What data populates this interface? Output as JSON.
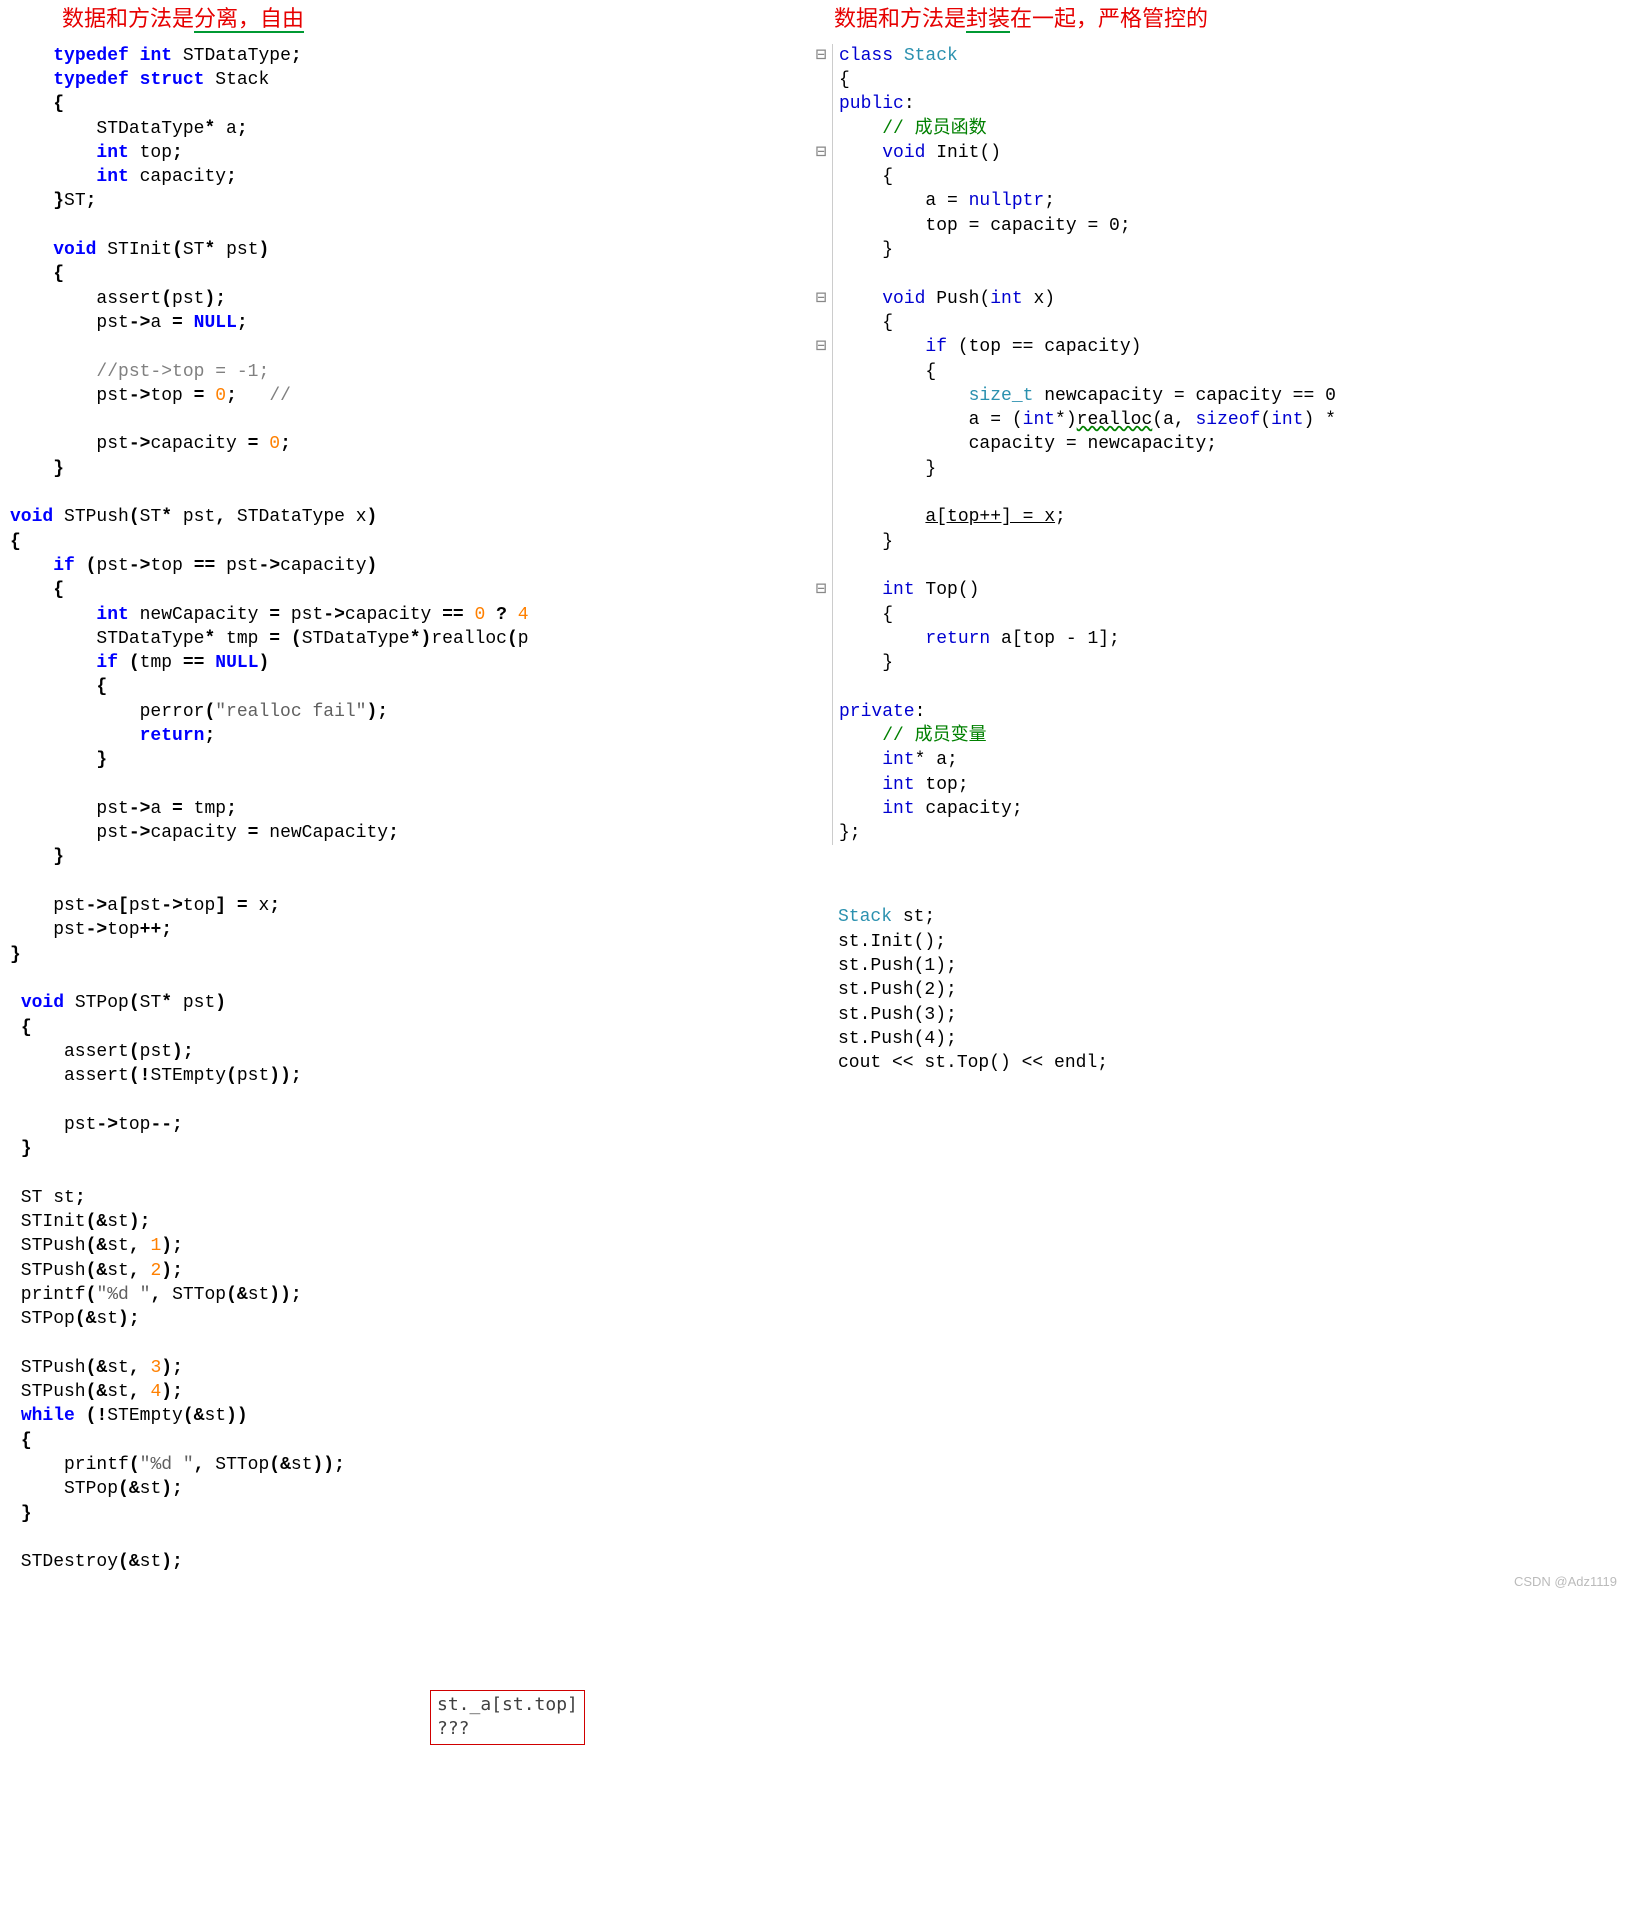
{
  "left": {
    "title_pre": "数据和方法是",
    "title_anno": "分离，自由",
    "code_block1": "    typedef int STDataType;\n    typedef struct Stack\n    {\n        STDataType* a;\n        int top;\n        int capacity;\n    }ST;\n\n    void STInit(ST* pst)\n    {\n        assert(pst);\n        pst->a = NULL;\n\n        //pst->top = -1;\n        pst->top = 0;   // \n\n        pst->capacity = 0;\n    }\n\nvoid STPush(ST* pst, STDataType x)\n{\n    if (pst->top == pst->capacity)\n    {\n        int newCapacity = pst->capacity == 0 ? 4\n        STDataType* tmp = (STDataType*)realloc(p\n        if (tmp == NULL)\n        {\n            perror(\"realloc fail\");\n            return;\n        }\n\n        pst->a = tmp;\n        pst->capacity = newCapacity;\n    }\n\n    pst->a[pst->top] = x;\n    pst->top++;\n}\n\n void STPop(ST* pst)\n {\n     assert(pst);\n     assert(!STEmpty(pst));\n\n     pst->top--;\n }\n\n ST st;\n STInit(&st);\n STPush(&st, 1);\n STPush(&st, 2);\n printf(\"%d \", STTop(&st));\n STPop(&st);\n\n STPush(&st, 3);\n STPush(&st, 4);\n while (!STEmpty(&st))\n {\n     printf(\"%d \", STTop(&st));\n     STPop(&st);\n }\n\n STDestroy(&st);",
    "redbox_line1": "st._a[st.top]",
    "redbox_line2": "???"
  },
  "right": {
    "title_pre": "数据和方法是",
    "title_anno": "封装",
    "title_post": "在一起，严格管控的",
    "class_code": "class Stack\n{\npublic:\n    // 成员函数\n    void Init()\n    {\n        a = nullptr;\n        top = capacity = 0;\n    }\n\n    void Push(int x)\n    {\n        if (top == capacity)\n        {\n            size_t newcapacity = capacity == 0\n            a = (int*)realloc(a, sizeof(int) *\n            capacity = newcapacity;\n        }\n\n        a[top++] = x;\n    }\n\n    int Top()\n    {\n        return a[top - 1];\n    }\n\nprivate:\n    // 成员变量\n    int* a;\n    int top;\n    int capacity;\n};",
    "usage_code": "Stack st;\nst.Init();\nst.Push(1);\nst.Push(2);\nst.Push(3);\nst.Push(4);\ncout << st.Top() << endl;"
  },
  "watermark": "CSDN @Adz1119"
}
